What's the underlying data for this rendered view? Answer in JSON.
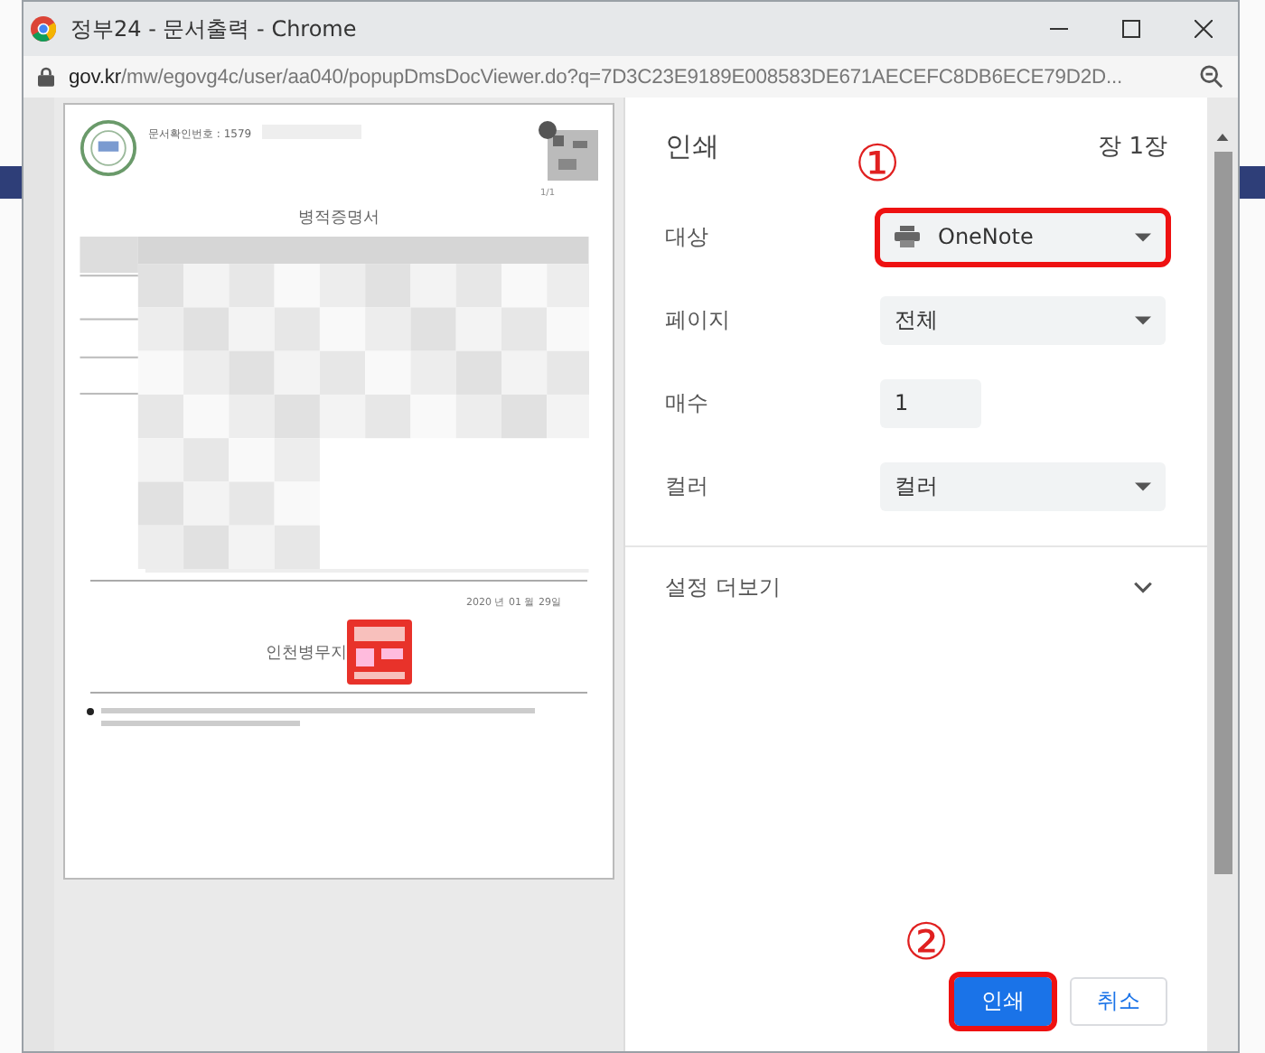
{
  "window": {
    "title": "정부24 - 문서출력 - Chrome",
    "url_domain": "gov.kr",
    "url_path": "/mw/egovg4c/user/aa040/popupDmsDocViewer.do?q=7D3C23E9189E008583DE671AECEFC8DB6ECE79D2D..."
  },
  "preview": {
    "doc_number": "문서확인번호 : 1579",
    "page_index": "1/1",
    "title": "병적증명서",
    "date": "2020 년 01 월 29일",
    "office": "인천병무지"
  },
  "print_panel": {
    "title": "인쇄",
    "sheet_count": "장 1장",
    "settings": [
      {
        "kind": "destination",
        "label": "대상",
        "value": "OneNote",
        "highlighted": true,
        "annotation": "①"
      },
      {
        "kind": "select",
        "label": "페이지",
        "value": "전체",
        "highlighted": false
      },
      {
        "kind": "number",
        "label": "매수",
        "value": "1",
        "highlighted": false
      },
      {
        "kind": "select",
        "label": "컬러",
        "value": "컬러",
        "highlighted": false
      }
    ],
    "more_settings": "설정 더보기",
    "buttons_annotation": "②",
    "buttons": [
      {
        "label": "인쇄",
        "kind": "primary",
        "highlighted": true
      },
      {
        "label": "취소",
        "kind": "secondary",
        "highlighted": false
      }
    ]
  }
}
